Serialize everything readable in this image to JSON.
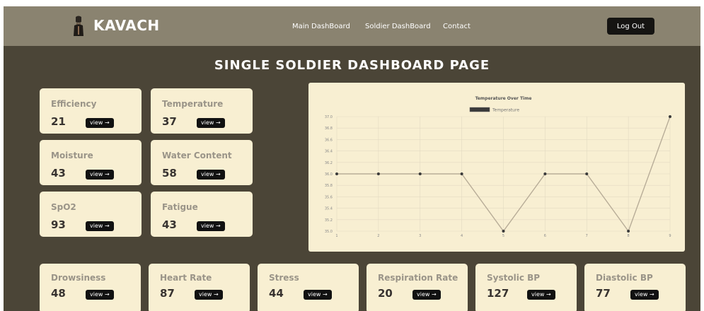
{
  "header": {
    "brand": "KAVACH",
    "logo_icon": "soldier-helmet-icon",
    "nav": [
      {
        "label": "Main DashBoard"
      },
      {
        "label": "Soldier DashBoard"
      },
      {
        "label": "Contact"
      }
    ],
    "logout_label": "Log Out"
  },
  "page_title": "SINGLE SOLDIER DASHBOARD PAGE",
  "view_label": "view",
  "view_icon": "arrow-right-icon",
  "cards": [
    {
      "label": "Efficiency",
      "value": "21"
    },
    {
      "label": "Temperature",
      "value": "37"
    },
    {
      "label": "Moisture",
      "value": "43"
    },
    {
      "label": "Water Content",
      "value": "58"
    },
    {
      "label": "SpO2",
      "value": "93"
    },
    {
      "label": "Fatigue",
      "value": "43"
    }
  ],
  "bottom_cards": [
    {
      "label": "Drowsiness",
      "value": "48"
    },
    {
      "label": "Heart Rate",
      "value": "87"
    },
    {
      "label": "Stress",
      "value": "44"
    },
    {
      "label": "Respiration Rate",
      "value": "20"
    },
    {
      "label": "Systolic BP",
      "value": "127"
    },
    {
      "label": "Diastolic BP",
      "value": "77"
    }
  ],
  "colors": {
    "background": "#4b4537",
    "navbar": "#8a8370",
    "card": "#f8efd2",
    "button": "#111111",
    "line": "#b8ad98",
    "point": "#3a3a3a"
  },
  "chart_data": {
    "type": "line",
    "title": "Temperature Over Time",
    "x": [
      1,
      2,
      3,
      4,
      5,
      6,
      7,
      8,
      9
    ],
    "series": [
      {
        "name": "Temperature",
        "values": [
          36,
          36,
          36,
          36,
          35,
          36,
          36,
          35,
          37
        ]
      }
    ],
    "ylim": [
      35.0,
      37.0
    ],
    "yticks": [
      "35.0",
      "35.2",
      "35.4",
      "35.6",
      "35.8",
      "36.0",
      "36.2",
      "36.4",
      "36.6",
      "36.8",
      "37.0"
    ],
    "xticks": [
      "1",
      "2",
      "3",
      "4",
      "5",
      "6",
      "7",
      "8",
      "9"
    ],
    "grid": true,
    "legend": "top"
  }
}
